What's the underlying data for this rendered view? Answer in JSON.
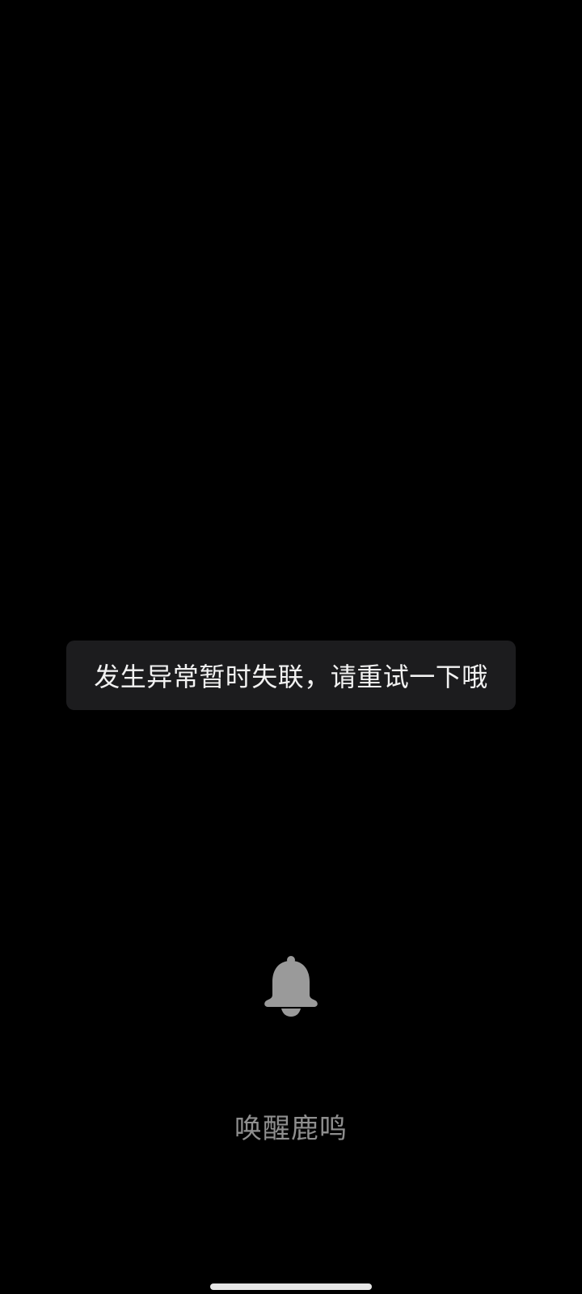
{
  "toast": {
    "message": "发生异常暂时失联，请重试一下哦"
  },
  "wake": {
    "icon": "bell-icon",
    "label": "唤醒鹿鸣"
  },
  "colors": {
    "background": "#000000",
    "toast_background": "#1c1c1e",
    "toast_text": "#f2f2f2",
    "icon": "#9a9a9a",
    "label": "#8e8e8e",
    "home_indicator": "#e6e6e6"
  }
}
